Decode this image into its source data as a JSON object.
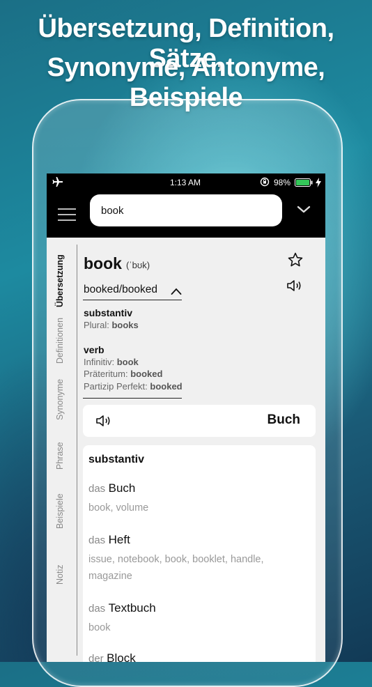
{
  "headline": {
    "line1": "Übersetzung, Definition, Sätze,",
    "line2": "Synonyme, Antonyme, Beispiele"
  },
  "status": {
    "time": "1:13 AM",
    "battery": "98%",
    "airplane_icon": "airplane-icon",
    "lock_icon": "rotation-lock-icon",
    "charging_icon": "bolt-icon"
  },
  "search": {
    "value": "book",
    "placeholder": ""
  },
  "sidebar": {
    "tabs": [
      {
        "label": "Übersetzung",
        "active": true
      },
      {
        "label": "Definitionen",
        "active": false
      },
      {
        "label": "Synonyme",
        "active": false
      },
      {
        "label": "Phrase",
        "active": false
      },
      {
        "label": "Beispiele",
        "active": false
      },
      {
        "label": "Notiz",
        "active": false
      }
    ]
  },
  "entry": {
    "word": "book",
    "phonetic": "(ˈbʊk)",
    "forms": "booked/booked",
    "noun": {
      "pos": "substantiv",
      "plural_label": "Plural:",
      "plural": "books"
    },
    "verb": {
      "pos": "verb",
      "inf_label": "Infinitiv:",
      "inf": "book",
      "pret_label": "Präteritum:",
      "pret": "booked",
      "part_label": "Partizip Perfekt:",
      "part": "booked"
    }
  },
  "translation": {
    "word": "Buch"
  },
  "list": {
    "header": "substantiv",
    "items": [
      {
        "article": "das",
        "noun": "Buch",
        "synonyms": "book, volume"
      },
      {
        "article": "das",
        "noun": "Heft",
        "synonyms": "issue, notebook, book, booklet, handle, magazine"
      },
      {
        "article": "das",
        "noun": "Textbuch",
        "synonyms": "book"
      },
      {
        "article": "der",
        "noun": "Block",
        "synonyms": ""
      }
    ]
  },
  "colors": {
    "accent": "#000000",
    "battery": "#34c759"
  }
}
